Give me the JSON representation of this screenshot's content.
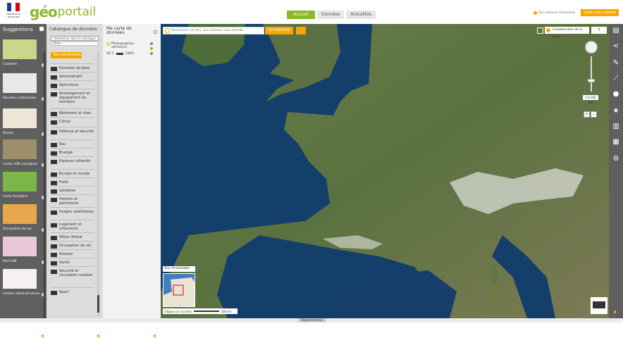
{
  "header": {
    "gov_logo_text": "RÉPUBLIQUE FRANÇAISE",
    "logo_part1": "géo",
    "logo_part2": "portail",
    "tabs": [
      {
        "label": "Accueil",
        "active": true
      },
      {
        "label": "Données",
        "active": false
      },
      {
        "label": "Actualités",
        "active": false
      }
    ],
    "notification": "Vos espaces Géoportail",
    "space_button": "Créer mon espace"
  },
  "suggestions": {
    "title": "Suggestions",
    "items": [
      {
        "label": "Cadastre",
        "color": "#c8d88a"
      },
      {
        "label": "Parcelles cadastrales",
        "color": "#e8e8e8"
      },
      {
        "label": "Routes",
        "color": "#f0e6d8"
      },
      {
        "label": "Cartes IGN classiques",
        "color": "#9e8e6a"
      },
      {
        "label": "Carte forestière",
        "color": "#7ab648"
      },
      {
        "label": "Occupation du sol",
        "color": "#e8a74c"
      },
      {
        "label": "Plan IGN",
        "color": "#e8c8d8"
      },
      {
        "label": "Limites administratives",
        "color": "#f4f0f4"
      }
    ]
  },
  "catalog": {
    "title": "Catalogue de données",
    "search_button": "Rechercher dans le catalogue",
    "filter_placeholder": "Filtrer",
    "all_button": "Tous les thèmes",
    "items": [
      "Données de base",
      "Administratif",
      "Agriculture",
      "Aménagement et équipement du territoire",
      "Bâtiments et sites",
      "Climat",
      "Défense et sécurité",
      "Eau",
      "Énergie",
      "Espaces collectifs",
      "Europe et monde",
      "Forêt",
      "Géodésie",
      "Histoire et patrimoine",
      "Images satellitaires",
      "Logement et urbanisme",
      "Milieu littoral",
      "Occupation du sol",
      "Risques",
      "Santé",
      "Sécurité et circulation routière",
      "Sport"
    ]
  },
  "map_panel": {
    "title": "Ma carte de données",
    "layer_name": "Photographies aériennes",
    "opacity": "100%",
    "layer_id": "GE 1"
  },
  "map": {
    "search_placeholder": "Rechercher un lieu, une adresse, une donnée",
    "search_button": "RECHERCHER",
    "coord_tool": "Coordonnées de la carte",
    "zoom_level": "6",
    "scale_label": "1:4 000 000",
    "overview_label": "Vue d'ensemble",
    "scale_text": "300 km",
    "scale_coords": "Cliquez sur la carte",
    "legal": "Réglementation",
    "colors": {
      "sea": "#143f6a",
      "land": "#4f6b3a",
      "mountains": "#e8ece8"
    }
  },
  "right_tools": [
    {
      "name": "print-icon",
      "glyph": "▤"
    },
    {
      "name": "share-icon",
      "glyph": "<"
    },
    {
      "name": "draw-icon",
      "glyph": "✎"
    },
    {
      "name": "measure-icon",
      "glyph": "⟋"
    },
    {
      "name": "location-icon",
      "glyph": "●"
    },
    {
      "name": "favorite-icon",
      "glyph": "★"
    },
    {
      "name": "map-icon",
      "glyph": "▥"
    },
    {
      "name": "document-icon",
      "glyph": "▦"
    },
    {
      "name": "settings-icon",
      "glyph": "⚙"
    }
  ],
  "bottom_label": "Réglementation"
}
